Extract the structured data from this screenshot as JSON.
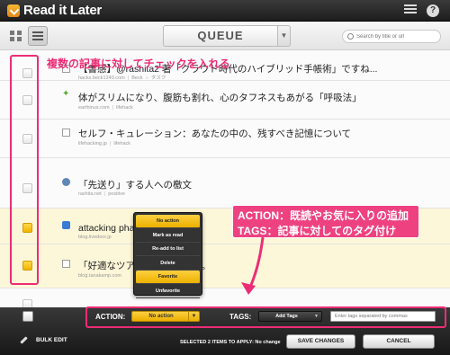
{
  "app": {
    "logo_text": "Read it Later",
    "help_glyph": "?"
  },
  "toolbar": {
    "queue_label": "QUEUE",
    "search_placeholder": "Search by title or url"
  },
  "annotations": {
    "checkbox_note": "複数の記事に対してチェックを入れる",
    "action_note": "ACTION：既読やお気に入りの追加",
    "tags_note": "TAGS：記事に対してのタグ付け"
  },
  "articles": [
    {
      "title": "【書感】@rashita2 著「クラウド時代のハイブリッド手帳術」ですね...",
      "source": "hacks.beck1240.com",
      "tags": [
        "Beck",
        "タスク"
      ],
      "checked": false,
      "favicon": "doc-icon"
    },
    {
      "title": "体がスリムになり、腹筋も割れ、心のタフネスもあがる「呼吸法」",
      "source": "earthinus.com",
      "tags": [
        "lifehack"
      ],
      "checked": false,
      "favicon": "leaf-icon"
    },
    {
      "title": "セルフ・キュレーション：あなたの中の、残すべき記憶について",
      "source": "lifehacking.jp",
      "tags": [
        "lifehack"
      ],
      "checked": false,
      "favicon": "doc-icon"
    },
    {
      "title": "「先送り」する人への檄文",
      "source": "rashita.net",
      "tags": [
        "positive"
      ],
      "checked": false,
      "favicon": "globe-icon"
    },
    {
      "title": "attacking phase ... 術・技術、",
      "source": "blog.livedoor.jp",
      "tags": [],
      "checked": true,
      "favicon": "blue-square-icon"
    },
    {
      "title": "「好適なツアー... 的ヒトコト。",
      "source": "blog.tanakamp.com",
      "tags": [],
      "checked": true,
      "favicon": "doc-icon"
    }
  ],
  "action_menu": {
    "items": [
      "No action",
      "Mark as read",
      "Re-add to list",
      "Delete",
      "Favorite",
      "Unfavorite"
    ],
    "highlighted": "Favorite"
  },
  "footer": {
    "action_label": "ACTION:",
    "action_value": "No action",
    "tags_label": "TAGS:",
    "tags_button": "Add Tags",
    "tags_placeholder": "Enter tags separated by commas",
    "bulk_edit": "BULK EDIT",
    "status": "SELECTED 2 ITEMS TO APPLY: No change",
    "save": "SAVE CHANGES",
    "cancel": "CANCEL"
  },
  "colors": {
    "accent": "#f1b400",
    "annotation": "#ec2d76",
    "dark_bar": "#1d1d1d"
  }
}
